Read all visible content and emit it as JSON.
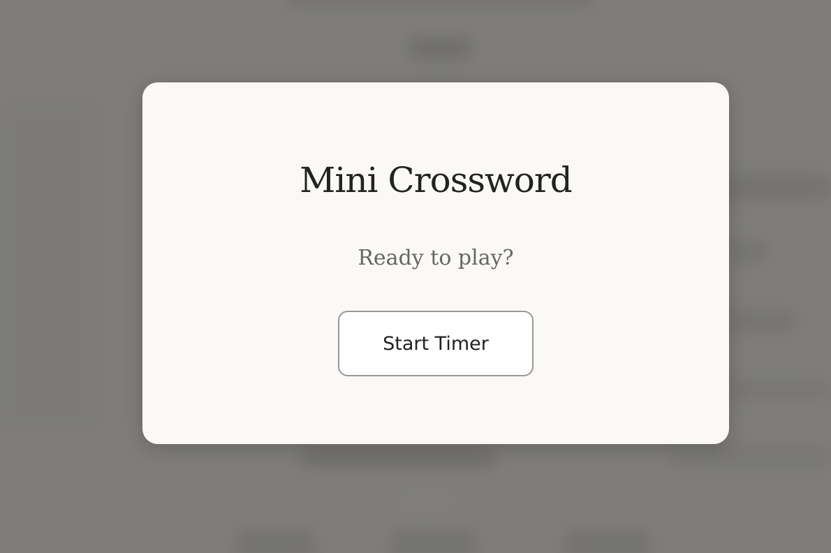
{
  "modal": {
    "title": "Mini Crossword",
    "subtitle": "Ready to play?",
    "start_button_label": "Start Timer"
  },
  "colors": {
    "backdrop": "#7e7d7b",
    "modal_background": "#faf9f6",
    "title_text": "#222222",
    "subtitle_text": "#666666",
    "button_border": "#999896",
    "button_background": "#ffffff"
  }
}
